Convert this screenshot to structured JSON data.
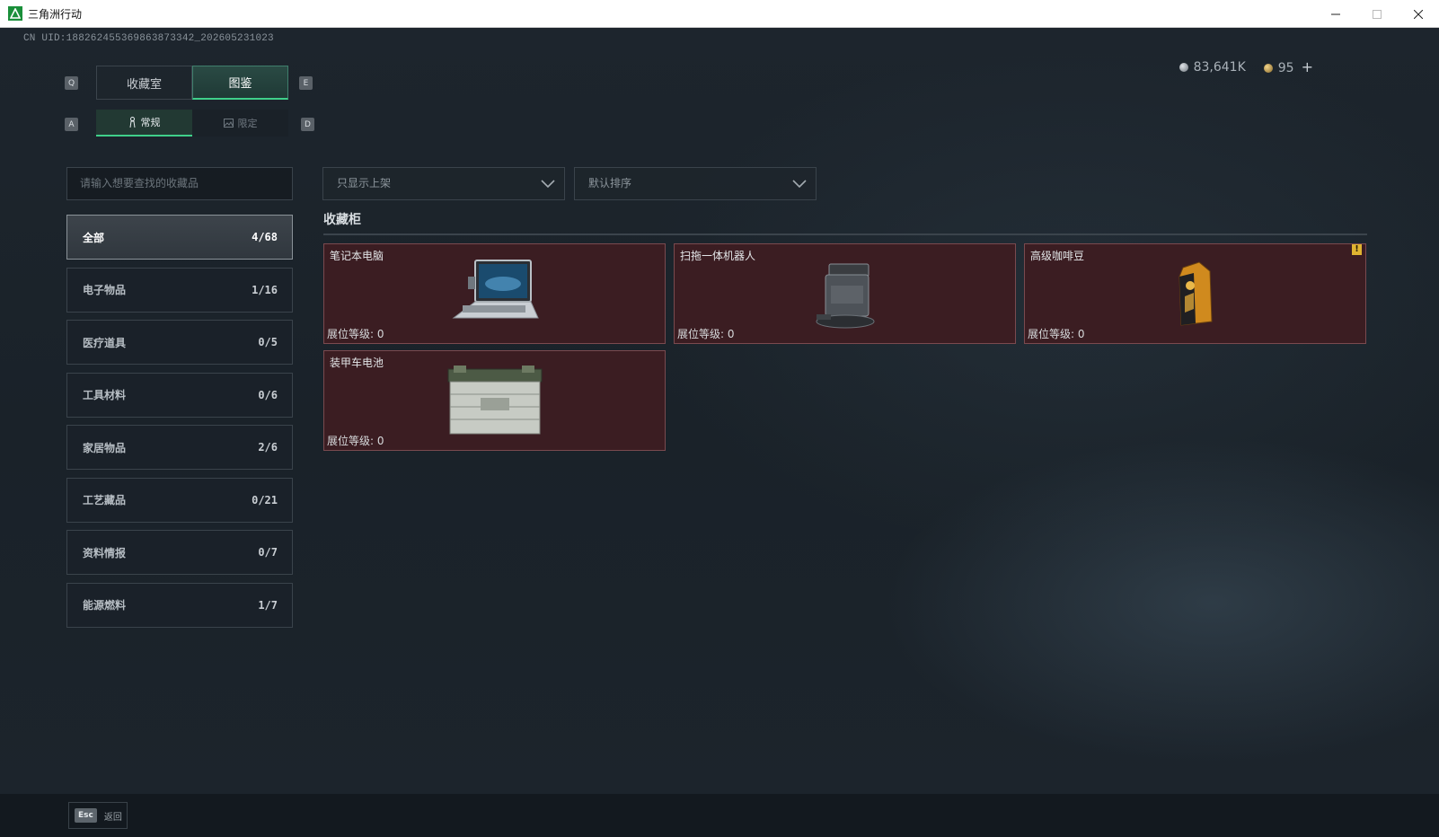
{
  "window": {
    "title": "三角洲行动"
  },
  "uid": "CN UID:188262455369863873342_202605231023",
  "currency": {
    "silver": "83,641K",
    "gold": "95",
    "add": "+"
  },
  "keys": {
    "q": "Q",
    "e": "E",
    "a": "A",
    "d": "D"
  },
  "tabs": [
    {
      "label": "收藏室",
      "active": false
    },
    {
      "label": "图鉴",
      "active": true
    }
  ],
  "subtabs": [
    {
      "label": "常规",
      "active": true
    },
    {
      "label": "限定",
      "active": false
    }
  ],
  "search": {
    "placeholder": "请输入想要查找的收藏品"
  },
  "filters": {
    "show": "只显示上架",
    "sort": "默认排序"
  },
  "categories": [
    {
      "label": "全部",
      "count": "4/68"
    },
    {
      "label": "电子物品",
      "count": "1/16"
    },
    {
      "label": "医疗道具",
      "count": "0/5"
    },
    {
      "label": "工具材料",
      "count": "0/6"
    },
    {
      "label": "家居物品",
      "count": "2/6"
    },
    {
      "label": "工艺藏品",
      "count": "0/21"
    },
    {
      "label": "资料情报",
      "count": "0/7"
    },
    {
      "label": "能源燃料",
      "count": "1/7"
    }
  ],
  "section": {
    "title": "收藏柜"
  },
  "items": [
    {
      "name": "笔记本电脑",
      "level": "展位等级: 0"
    },
    {
      "name": "扫拖一体机器人",
      "level": "展位等级: 0"
    },
    {
      "name": "高级咖啡豆",
      "level": "展位等级: 0",
      "warning": "!"
    },
    {
      "name": "装甲车电池",
      "level": "展位等级: 0"
    }
  ],
  "footer": {
    "esc_key": "Esc",
    "esc_label": "返回"
  },
  "colors": {
    "accent": "#3fd08a",
    "card_bg": "#3b1d22",
    "card_border": "#7a4a4f"
  }
}
